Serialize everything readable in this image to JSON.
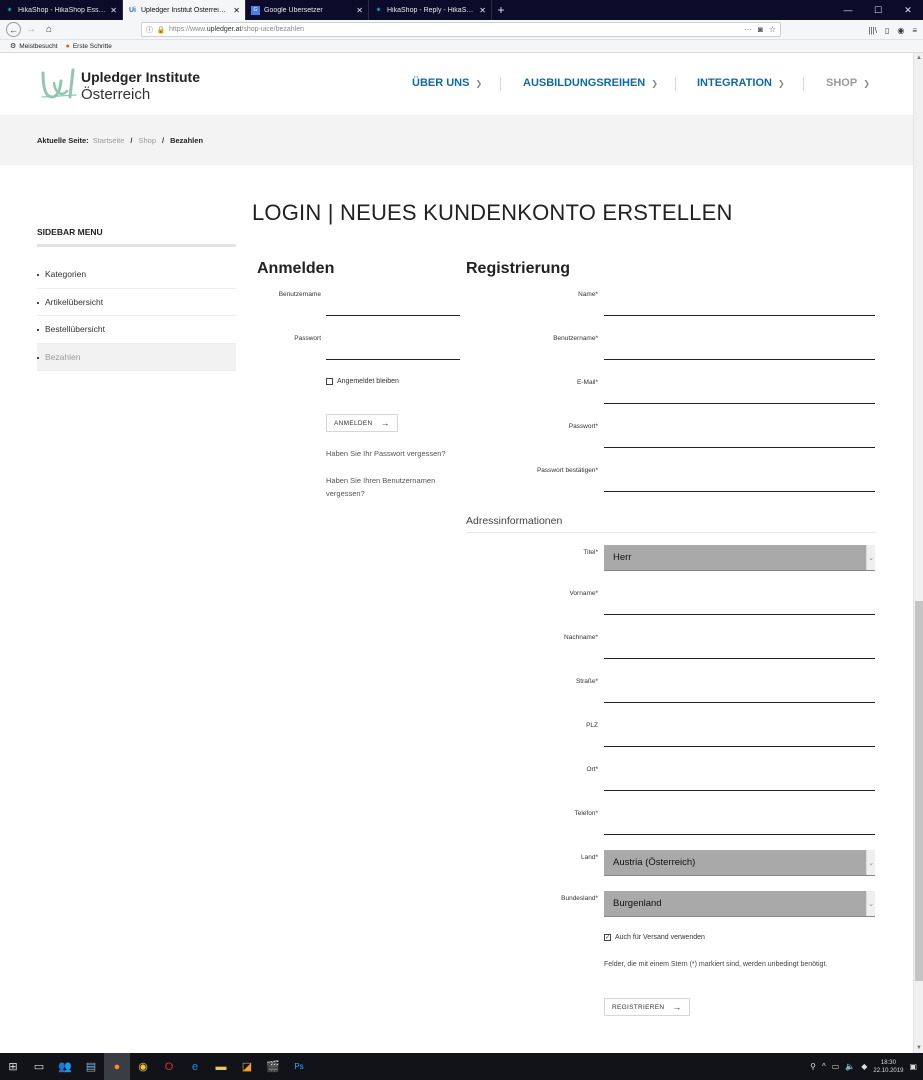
{
  "browser": {
    "tabs": [
      {
        "title": "HikaShop - HikaShop Essential",
        "icon": "hikashop-icon",
        "active": false
      },
      {
        "title": "Upledger Institut Österreich - K",
        "icon": "upledger-icon",
        "active": true
      },
      {
        "title": "Google Übersetzer",
        "icon": "google-translate-icon",
        "active": false
      },
      {
        "title": "HikaShop - Reply - HikaShop",
        "icon": "hikashop-icon",
        "active": false
      }
    ],
    "url_prefix": "https://www.",
    "url_domain": "upledger.at",
    "url_path": "/shop-uice/bezahlen",
    "bookmarks": [
      {
        "label": "Meistbesucht",
        "icon": "gear-icon"
      },
      {
        "label": "Erste Schritte",
        "icon": "firefox-icon"
      }
    ]
  },
  "header": {
    "logo_title": "Upledger Institute",
    "logo_sub": "Österreich",
    "nav": [
      {
        "label": "ÜBER UNS"
      },
      {
        "label": "AUSBILDUNGSREIHEN"
      },
      {
        "label": "INTEGRATION"
      },
      {
        "label": "SHOP"
      }
    ]
  },
  "breadcrumb": {
    "label": "Aktuelle Seite:",
    "items": [
      "Startseite",
      "Shop"
    ],
    "current": "Bezahlen"
  },
  "sidebar": {
    "title": "SIDEBAR MENU",
    "items": [
      "Kategorien",
      "Artikelübersicht",
      "Bestellübersicht",
      "Bezahlen"
    ]
  },
  "page": {
    "title": "LOGIN | NEUES KUNDENKONTO ERSTELLEN"
  },
  "login": {
    "title": "Anmelden",
    "username_label": "Benutzername",
    "password_label": "Passwort",
    "remember_label": "Angemeldet bleiben",
    "submit_label": "ANMELDEN",
    "forgot_password": "Haben Sie Ihr Passwort vergessen?",
    "forgot_username": "Haben Sie Ihren Benutzernamen vergessen?"
  },
  "register": {
    "title": "Registrierung",
    "name_label": "Name*",
    "username_label": "Benutzername*",
    "email_label": "E-Mail*",
    "password_label": "Passwort*",
    "password_confirm_label": "Passwort bestätigen*",
    "address_title": "Adressinformationen",
    "title_label": "Titel*",
    "title_value": "Herr",
    "firstname_label": "Vorname*",
    "lastname_label": "Nachname*",
    "street_label": "Straße*",
    "zip_label": "PLZ",
    "city_label": "Ort*",
    "phone_label": "Telefon*",
    "country_label": "Land*",
    "country_value": "Austria (Österreich)",
    "state_label": "Bundesland*",
    "state_value": "Burgenland",
    "shipping_label": "Auch für Versand verwenden",
    "required_note": "Felder, die mit einem Stern (*) markiert sind, werden unbedingt benötigt.",
    "submit_label": "REGISTRIEREN"
  },
  "taskbar": {
    "time": "18:30",
    "date": "22.10.2019"
  },
  "colors": {
    "nav_blue": "#0d6aa6",
    "logo_green": "#8fc7b0",
    "select_gray": "#a9a9a9"
  }
}
